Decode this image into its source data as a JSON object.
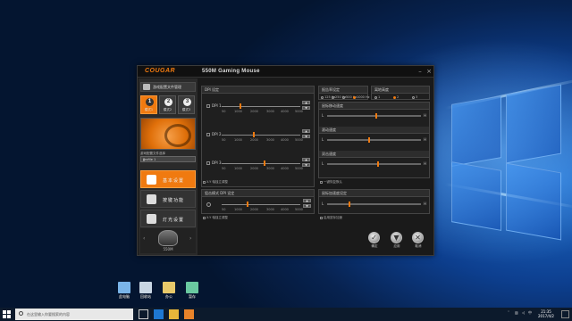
{
  "window": {
    "brand": "COUGAR",
    "title": "550M Gaming Mouse",
    "controls": {
      "minimize": "–",
      "close": "×"
    }
  },
  "sidebar": {
    "header_label": "游戏配置文件管理",
    "modes": [
      {
        "num": "1",
        "label": "模式1"
      },
      {
        "num": "2",
        "label": "模式2"
      },
      {
        "num": "3",
        "label": "模式3"
      }
    ],
    "profile_label": "游戏配置文件选择",
    "profile_value": "Profile 1",
    "nav": [
      {
        "label": "基本设置",
        "icon": "settings-icon"
      },
      {
        "label": "按键功能",
        "icon": "buttons-icon"
      },
      {
        "label": "灯光设置",
        "icon": "lightbulb-icon"
      }
    ],
    "mouse_name": "550M",
    "prev": "‹",
    "next": "›"
  },
  "dpi": {
    "title": "DPI 设定",
    "rows": [
      {
        "name": "DPI 1",
        "ticks": [
          "50",
          "1000",
          "2000",
          "3000",
          "4000",
          "5000"
        ]
      },
      {
        "name": "DPI 2",
        "ticks": [
          "50",
          "1000",
          "2000",
          "3000",
          "4000",
          "5000"
        ]
      },
      {
        "name": "DPI 3",
        "ticks": [
          "50",
          "1000",
          "2000",
          "3000",
          "4000",
          "5000"
        ]
      }
    ],
    "xy_note": "X-Y 轴独立调整"
  },
  "sniper": {
    "title": "狙击模式 DPI 设定",
    "ticks": [
      "50",
      "1000",
      "2000",
      "3000",
      "4000",
      "5000"
    ],
    "xy_note": "X-Y 轴独立调整"
  },
  "right": {
    "rate_title": "报告率设定",
    "rate_options": [
      "125 Hz",
      "250 Hz",
      "500 Hz",
      "1000 Hz"
    ],
    "rate_selected": "1000 Hz",
    "lift_title": "离地高度",
    "lift_options": [
      "1",
      "2",
      "3"
    ],
    "slider_titles": [
      "鼠标移动速度",
      "滚动速度",
      "双击速度"
    ],
    "left_mark": "L",
    "right_mark": "H",
    "default_note": "一键恢复默认",
    "accel_title": "鼠标加速度设定",
    "accel_note": "启用鼠标加速"
  },
  "actions": [
    {
      "label": "确定",
      "icon": "check-icon",
      "glyph": "✓"
    },
    {
      "label": "应用",
      "icon": "apply-icon",
      "glyph": "▼"
    },
    {
      "label": "取消",
      "icon": "cancel-icon",
      "glyph": "✕"
    }
  ],
  "desktop": {
    "icons": [
      {
        "label": "此电脑",
        "color": "#7ab4e8"
      },
      {
        "label": "回收站",
        "color": "#c9d6e3"
      },
      {
        "label": "办公",
        "color": "#e8c96a"
      },
      {
        "label": "暂存",
        "color": "#6ac9a0"
      }
    ]
  },
  "taskbar": {
    "search_placeholder": "在这里输入你要搜索的内容",
    "time": "21:35",
    "date": "2017/4/2",
    "ime": "中"
  },
  "colors": {
    "accent": "#f07a10",
    "desktop": "#0d3f8f"
  }
}
